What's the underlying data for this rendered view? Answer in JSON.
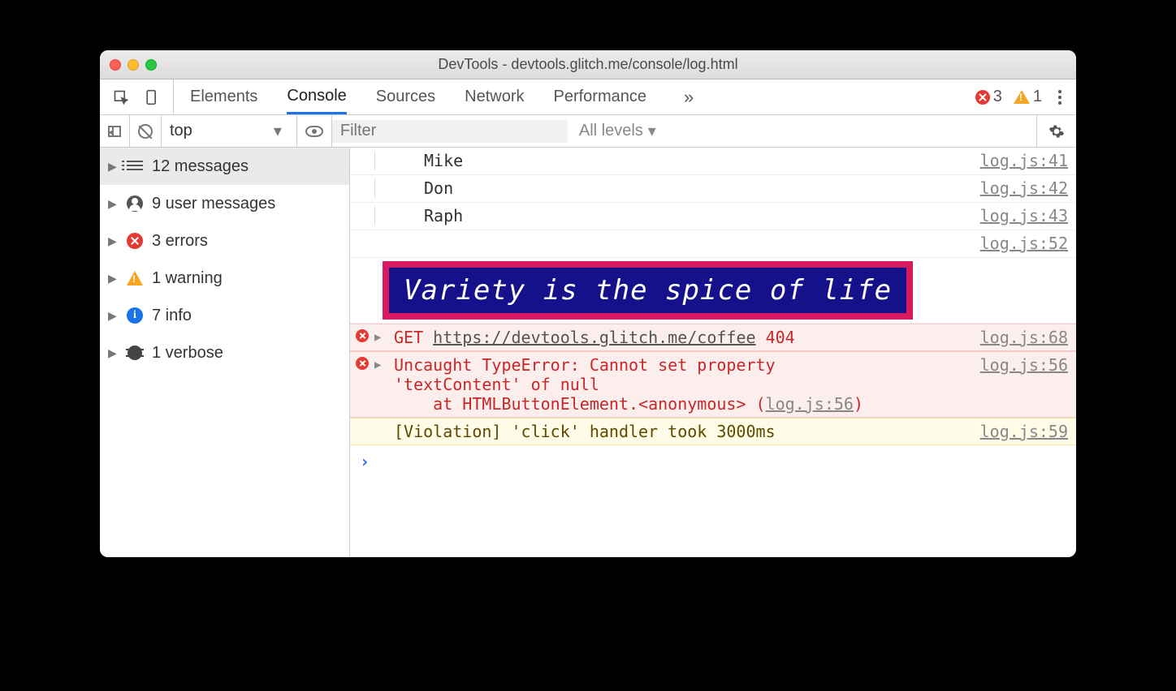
{
  "window": {
    "title": "DevTools - devtools.glitch.me/console/log.html"
  },
  "tabs": {
    "items": [
      "Elements",
      "Console",
      "Sources",
      "Network",
      "Performance"
    ],
    "overflow": "»",
    "errorCount": "3",
    "warnCount": "1"
  },
  "toolbar": {
    "context": "top",
    "filterPlaceholder": "Filter",
    "levels": "All levels"
  },
  "sidebar": {
    "messages": "12 messages",
    "user": "9 user messages",
    "errors": "3 errors",
    "warnings": "1 warning",
    "info": "7 info",
    "verbose": "1 verbose"
  },
  "logs": {
    "l1": {
      "text": "Mike",
      "src": "log.js:41"
    },
    "l2": {
      "text": "Don",
      "src": "log.js:42"
    },
    "l3": {
      "text": "Raph",
      "src": "log.js:43"
    },
    "spacer": {
      "src": "log.js:52"
    },
    "styled": {
      "text": "Variety is the spice of life"
    },
    "getErr": {
      "method": "GET",
      "url": "https://devtools.glitch.me/coffee",
      "status": "404",
      "src": "log.js:68"
    },
    "typeErr": {
      "line1": "Uncaught TypeError: Cannot set property",
      "line2": "'textContent' of null",
      "stackPrefix": "at HTMLButtonElement.",
      "anon": "<anonymous>",
      "stackLoc": "log.js:56",
      "src": "log.js:56"
    },
    "violation": {
      "text": "[Violation] 'click' handler took 3000ms",
      "src": "log.js:59"
    }
  },
  "prompt": "›"
}
